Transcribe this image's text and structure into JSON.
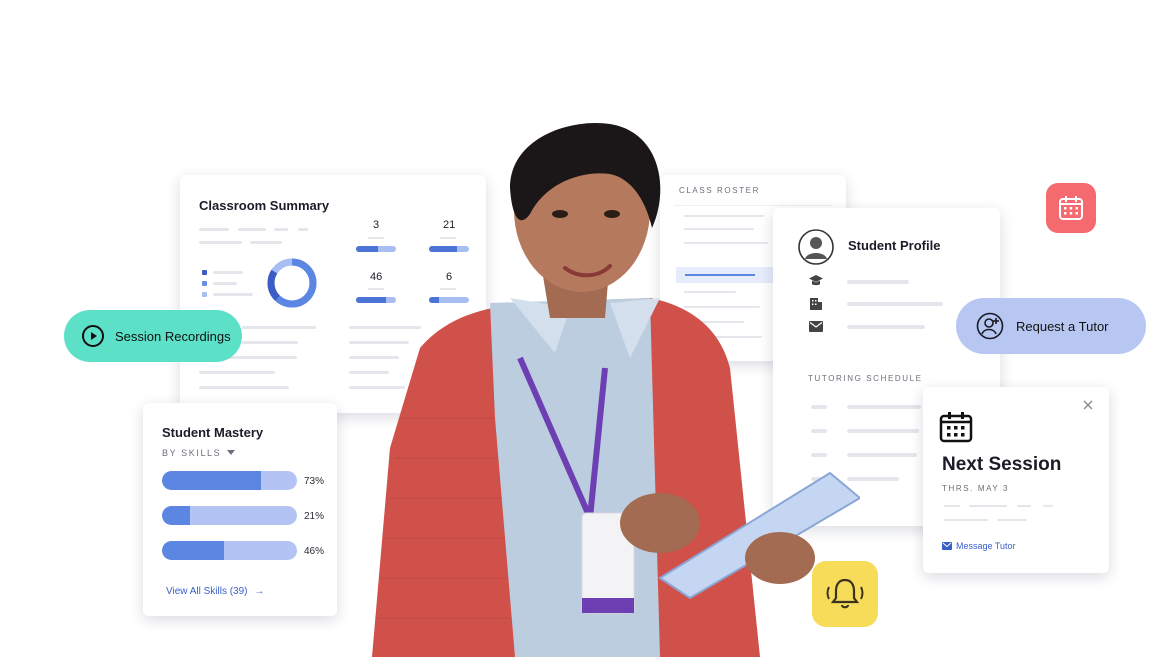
{
  "colors": {
    "accent_blue": "#5b86e1",
    "light_blue": "#b3c4f4",
    "teal_pill": "#5de0c8",
    "lavender_pill": "#b8c6f2",
    "calendar_red": "#f46a6f",
    "bell_yellow": "#f7dc5a",
    "cardigan_red": "#d0504a"
  },
  "classroom_summary": {
    "title": "Classroom Summary",
    "stats": [
      {
        "value": "3",
        "fill": 0.55
      },
      {
        "value": "21",
        "fill": 0.7
      },
      {
        "value": "46",
        "fill": 0.75
      },
      {
        "value": "6",
        "fill": 0.25
      }
    ],
    "donut": {
      "segments": [
        0.62,
        0.22,
        0.16
      ]
    }
  },
  "session_recordings": {
    "label": "Session Recordings",
    "icon": "play-circle-icon"
  },
  "student_mastery": {
    "title": "Student Mastery",
    "filter_label": "BY SKILLS",
    "skills": [
      {
        "percent": 73,
        "label": "73%"
      },
      {
        "percent": 21,
        "label": "21%"
      },
      {
        "percent": 46,
        "label": "46%"
      }
    ],
    "view_all": "View All Skills (39)"
  },
  "class_roster": {
    "title": "CLASS ROSTER"
  },
  "student_profile": {
    "title": "Student Profile",
    "schedule_title": "TUTORING SCHEDULE",
    "rows": [
      {
        "icon": "graduation-cap-icon"
      },
      {
        "icon": "building-icon"
      },
      {
        "icon": "mail-icon"
      }
    ]
  },
  "request_tutor": {
    "label": "Request a Tutor",
    "icon": "person-add-icon"
  },
  "next_session": {
    "title": "Next Session",
    "date": "THRS. MAY 3",
    "message_link": "Message Tutor"
  },
  "floating_icons": {
    "calendar": "calendar-icon",
    "bell": "bell-ringing-icon"
  }
}
